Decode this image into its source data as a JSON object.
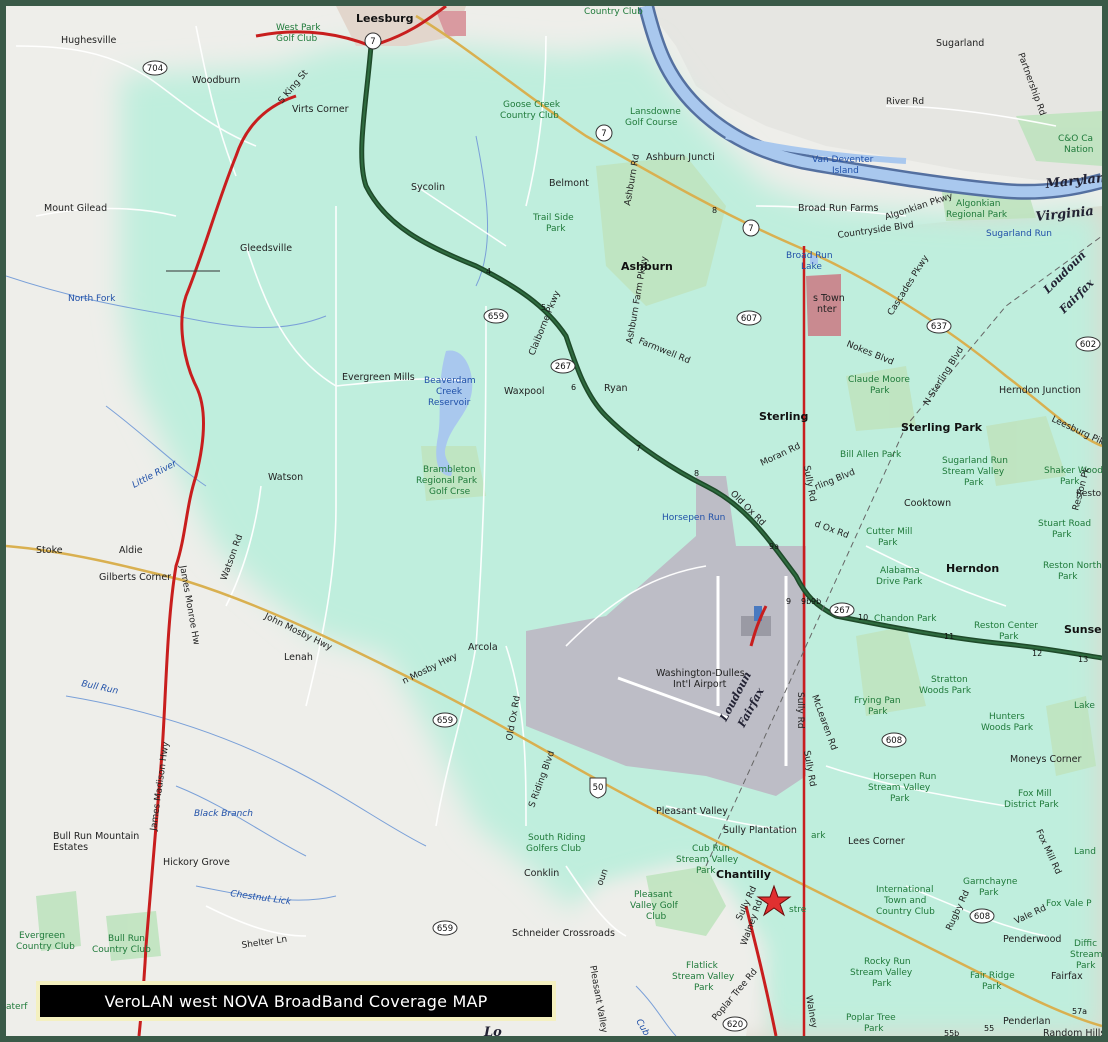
{
  "caption": "VeroLAN west NOVA BroadBand Coverage MAP",
  "colors": {
    "coverage": "#bfeedd",
    "water": "#a9c8ee",
    "interstate": "#2e6b3f",
    "us_route": "#c81e1e",
    "state_road": "#d9b050",
    "airport": "#bdbdc6",
    "park": "#bfe3bf",
    "frame": "#3a5a48",
    "caption_border": "#f4f0c0"
  },
  "towns": {
    "leesburg": "Leesburg",
    "ashburn": "Ashburn",
    "sterling": "Sterling",
    "sterling_park": "Sterling Park",
    "herndon": "Herndon",
    "chantilly": "Chantilly",
    "sunset": "Sunse"
  },
  "places": {
    "hughesville": "Hughesville",
    "woodburn": "Woodburn",
    "virts_corner": "Virts Corner",
    "mount_gilead": "Mount Gilead",
    "gleedsville": "Gleedsville",
    "sycolin": "Sycolin",
    "belmont": "Belmont",
    "ashburn_junction": "Ashburn Juncti",
    "sugarland": "Sugarland",
    "broad_run_farms": "Broad Run Farms",
    "evergreen_mills": "Evergreen Mills",
    "waxpool": "Waxpool",
    "ryan": "Ryan",
    "watson": "Watson",
    "stoke": "Stoke",
    "aldie": "Aldie",
    "gilberts_corner": "Gilberts Corner",
    "lenah": "Lenah",
    "arcola": "Arcola",
    "washington_dulles": "Washington-Dulles",
    "intl_airport": "Int'l Airport",
    "pleasant_valley": "Pleasant Valley",
    "sully_plantation": "Sully Plantation",
    "lees_corner": "Lees Corner",
    "conklin": "Conklin",
    "schneider_crossroads": "Schneider Crossroads",
    "hickory_grove": "Hickory Grove",
    "bull_run_mountain": "Bull Run Mountain",
    "estates": "Estates",
    "herndon_junction": "Herndon Junction",
    "cooktown": "Cooktown",
    "moneys_corner": "Moneys Corner",
    "penderwood": "Penderwood",
    "fairfax": "Fairfax",
    "penderlan": "Penderlan",
    "random_hills": "Random Hills",
    "s_town_center_1": "s Town",
    "s_town_center_2": "nter"
  },
  "parks": {
    "west_park_1": "West Park",
    "west_park_2": "Golf Club",
    "country_club": "Country Club",
    "goose_creek_1": "Goose Creek",
    "goose_creek_2": "Country Club",
    "lansdowne_1": "Lansdowne",
    "lansdowne_2": "Golf Course",
    "trail_side_1": "Trail Side",
    "trail_side_2": "Park",
    "algonkian_1": "Algonkian",
    "algonkian_2": "Regional Park",
    "co_canal_1": "C&O Ca",
    "co_canal_2": "Nation",
    "claude_moore_1": "Claude Moore",
    "claude_moore_2": "Park",
    "bill_allen": "Bill Allen Park",
    "sugarland_valley_1": "Sugarland Run",
    "sugarland_valley_2": "Stream Valley",
    "sugarland_valley_3": "Park",
    "shaker_wood_1": "Shaker Wood",
    "shaker_wood_2": "Park",
    "stuart_road_1": "Stuart Road",
    "stuart_road_2": "Park",
    "reston_north_1": "Reston North",
    "reston_north_2": "Park",
    "cutter_mill_1": "Cutter Mill",
    "cutter_mill_2": "Park",
    "alabama_1": "Alabama",
    "alabama_2": "Drive Park",
    "chandon": "Chandon Park",
    "reston_center_1": "Reston Center",
    "reston_center_2": "Park",
    "stratton_1": "Stratton",
    "stratton_2": "Woods Park",
    "frying_pan_1": "Frying Pan",
    "frying_pan_2": "Park",
    "hunters_1": "Hunters",
    "hunters_2": "Woods Park",
    "horsepen_park_1": "Horsepen Run",
    "horsepen_park_2": "Stream Valley",
    "horsepen_park_3": "Park",
    "fox_mill_1": "Fox Mill",
    "fox_mill_2": "District Park",
    "brambleton_1": "Brambleton",
    "brambleton_2": "Regional Park",
    "brambleton_3": "Golf Crse",
    "south_riding_1": "South Riding",
    "south_riding_2": "Golfers Club",
    "cub_run_1": "Cub Run",
    "cub_run_2": "Stream Valley",
    "cub_run_3": "Park",
    "pleasant_valley_golf_1": "Pleasant",
    "pleasant_valley_golf_2": "Valley Golf",
    "pleasant_valley_golf_3": "Club",
    "international_1": "International",
    "international_2": "Town and",
    "international_3": "Country Club",
    "garnchayne_1": "Garnchayne",
    "garnchayne_2": "Park",
    "evergreen_1": "Evergreen",
    "evergreen_2": "Country Club",
    "bull_run_cc_1": "Bull Run",
    "bull_run_cc_2": "Country Club",
    "flatlick_1": "Flatlick",
    "flatlick_2": "Stream Valley",
    "flatlick_3": "Park",
    "rocky_run_1": "Rocky Run",
    "rocky_run_2": "Stream Valley",
    "rocky_run_3": "Park",
    "fair_ridge_1": "Fair Ridge",
    "fair_ridge_2": "Park",
    "poplar_tree_1": "Poplar Tree",
    "poplar_tree_2": "Park",
    "fox_vale": "Fox Vale P",
    "difficult_1": "Diffic",
    "difficult_2": "Stream",
    "difficult_3": "Park",
    "lake": "Lake",
    "land_partial": "Land",
    "aterf": "aterf",
    "stre": "stre",
    "ark": "ark"
  },
  "water": {
    "north_fork": "North Fork",
    "little_river": "Little River",
    "bull_run": "Bull Run",
    "black_branch": "Black Branch",
    "chestnut_lick": "Chestnut Lick",
    "beaverdam_1": "Beaverdam",
    "beaverdam_2": "Creek",
    "beaverdam_3": "Reservoir",
    "broad_run_lake_1": "Broad Run",
    "broad_run_lake_2": "Lake",
    "horsepen_run": "Horsepen Run",
    "van_deventer_1": "Van Deventer",
    "van_deventer_2": "Island",
    "sugarland_run": "Sugarland Run",
    "cub_run": "Cub Run"
  },
  "states": {
    "maryland": "Marylan",
    "virginia": "Virginia",
    "loudoun": "Loudoun",
    "fairfax": "Fairfax",
    "loudoun_2": "Loudoun",
    "fairfax_2": "Fairfax",
    "lo": "Lo"
  },
  "roads": {
    "s_king_st": "S King St",
    "river_rd": "River Rd",
    "partnership_rd": "Partnership Rd",
    "ashburn_rd": "Ashburn Rd",
    "countryside_blvd": "Countryside Blvd",
    "algonkian_pkwy": "Algonkian Pkwy",
    "cascades_pkwy": "Cascades Pkwy",
    "claiborne_pkwy": "Claiborne Pkwy",
    "ashburn_farm_pkwy": "Ashburn Farm Pkwy",
    "farmwell_rd": "Farmwell Rd",
    "nokes_blvd": "Nokes Blvd",
    "n_sterling_blvd": "N Sterling Blvd",
    "moran_rd": "Moran Rd",
    "sully_rd": "Sully Rd",
    "sterling_blvd": "rling Blvd",
    "leesburg_pike": "Leesburg Pik",
    "reston_pkwy": "Reston Pk",
    "old_ox_rd": "Old Ox Rd",
    "old_ox_rd_2": "d Ox Rd",
    "watson_rd": "Watson Rd",
    "james_monroe_hwy": "James Monroe Hw",
    "james_madison_hwy": "James Madison Hwy",
    "john_mosby_hwy": "John Mosby Hwy",
    "john_mosby_hwy_2": "n Mosby Hwy",
    "old_ox_rd_3": "Old Ox Rd",
    "s_riding_blvd": "S Riding Blvd",
    "mclearen_rd": "McLearen Rd",
    "sully_rd_2": "Sully Rd",
    "sully_rd_3": "Sully Rd",
    "shelter_ln": "Shelter Ln",
    "pleasant_valley_rd": "Pleasant Valley",
    "poplar_tree_rd": "Poplar Tree Rd",
    "walney_rd": "Walney Rd",
    "walney_2": "Walney",
    "sully_2": "Sully Rd",
    "rugby_rd": "Rugby Rd",
    "vale_rd": "Vale Rd",
    "fox_mill_rd": "Fox Mill Rd",
    "loun": "oun",
    "ruston": "Reston"
  },
  "shields": {
    "r7a": "7",
    "r7b": "7",
    "r7c": "7",
    "r704": "704",
    "r659a": "659",
    "r267": "267",
    "r607": "607",
    "r637": "637",
    "r602": "602",
    "r267b": "267",
    "r608": "608",
    "r659b": "659",
    "r50": "50",
    "r659c": "659",
    "r620": "620",
    "r608b": "608"
  },
  "exits": {
    "e4": "4",
    "e5": "5",
    "e6": "6",
    "e7": "7",
    "e8": "8",
    "e9a": "9a",
    "e9": "9",
    "e9b": "9b",
    "e9c": "9b",
    "e10": "10",
    "e11": "11",
    "e12": "12",
    "e13": "13",
    "e55b": "55b",
    "e55": "55",
    "e57a": "57a",
    "e8b": "8",
    "e7x": "7"
  }
}
